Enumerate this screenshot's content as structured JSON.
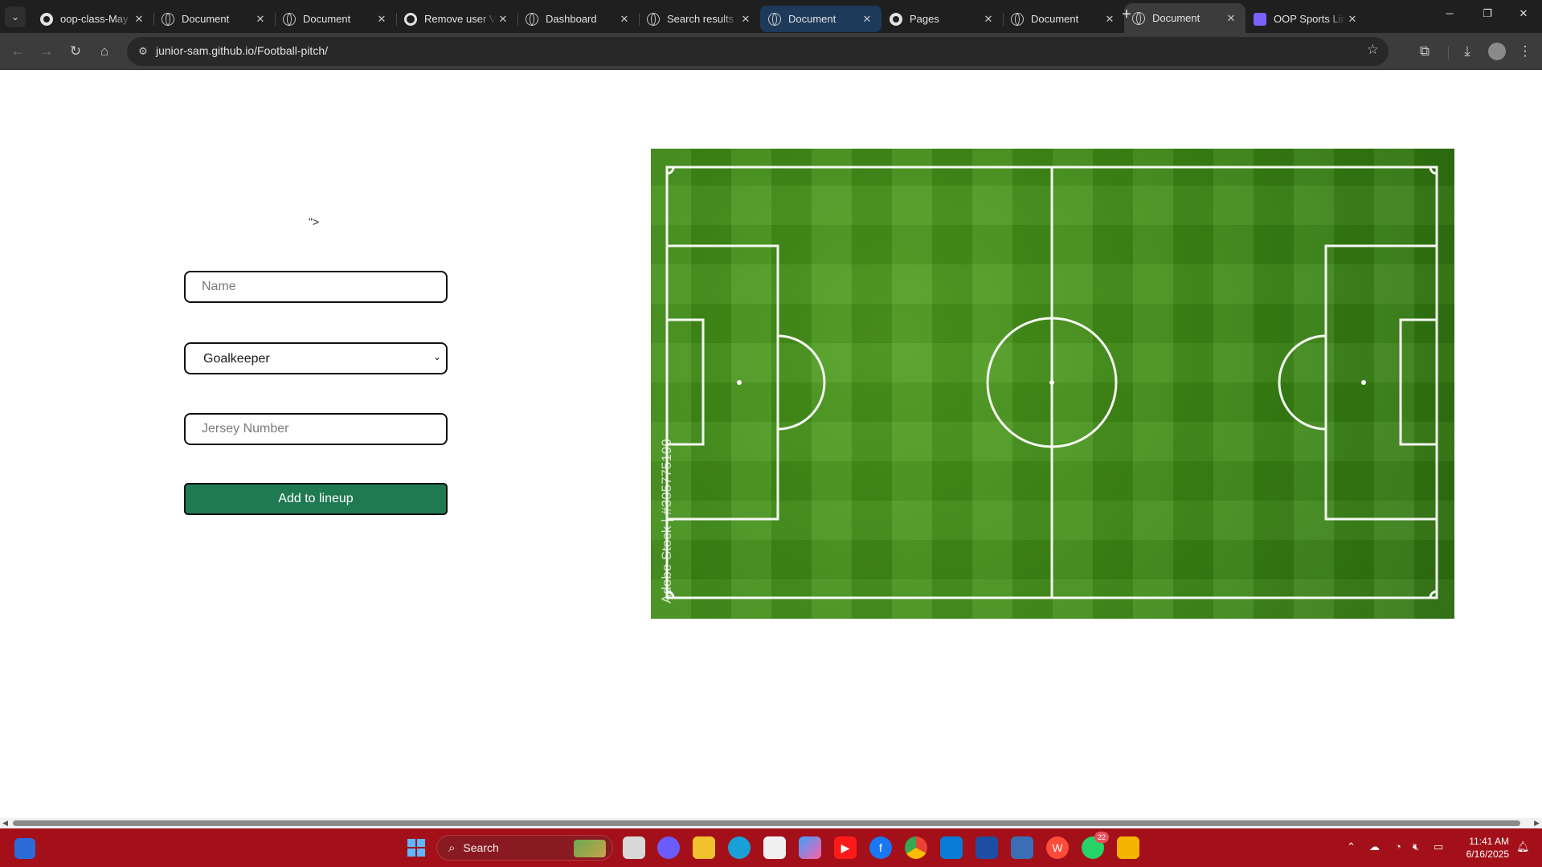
{
  "browser": {
    "tabs": [
      {
        "title": "oop-class-May",
        "favicon": "github-icon"
      },
      {
        "title": "Document",
        "favicon": "globe-icon"
      },
      {
        "title": "Document",
        "favicon": "globe-icon"
      },
      {
        "title": "Remove user V",
        "favicon": "ring-icon"
      },
      {
        "title": "Dashboard",
        "favicon": "globe-icon"
      },
      {
        "title": "Search results",
        "favicon": "globe-icon"
      },
      {
        "title": "Document",
        "favicon": "globe-icon"
      },
      {
        "title": "Pages",
        "favicon": "github-icon"
      },
      {
        "title": "Document",
        "favicon": "globe-icon"
      },
      {
        "title": "Document",
        "favicon": "globe-icon"
      },
      {
        "title": "OOP Sports Lin",
        "favicon": "sheet-icon"
      }
    ],
    "active_tab_index": 9,
    "highlighted_tab_index": 6,
    "address": {
      "host": "junior-sam.github.io",
      "path": "/Football-pitch/"
    }
  },
  "page": {
    "stray_text": "\">",
    "name_input": {
      "placeholder": "Name",
      "value": ""
    },
    "position_select": {
      "selected": "Goalkeeper"
    },
    "jersey_input": {
      "placeholder": "Jersey Number",
      "value": ""
    },
    "add_button_label": "Add to lineup",
    "pitch": {
      "watermark": "Adobe Stock | #305775190",
      "grass_color": "#3c8a14",
      "line_color": "#ffffff"
    }
  },
  "taskbar": {
    "search_label": "Search",
    "whatsapp_badge": "22",
    "facebook_badge": "",
    "time": "11:41 AM",
    "date": "6/16/2025",
    "accent": "#a3101a"
  }
}
